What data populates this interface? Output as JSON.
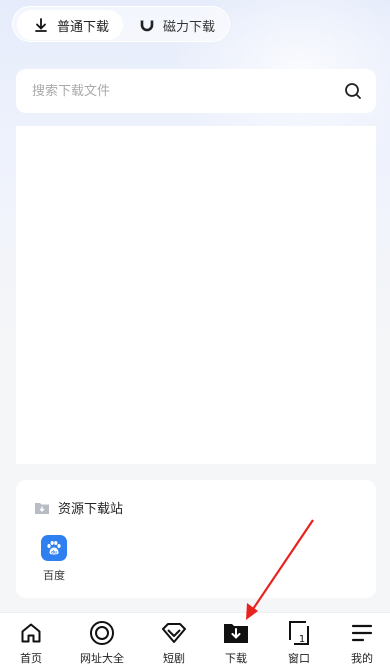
{
  "segmented": {
    "normal_label": "普通下载",
    "magnet_label": "磁力下载"
  },
  "search": {
    "placeholder": "搜索下载文件"
  },
  "resources": {
    "title": "资源下载站",
    "sites": [
      {
        "label": "百度",
        "icon": "baidu-paw-icon",
        "color": "#2e7ff0"
      }
    ]
  },
  "tabbar": {
    "items": [
      {
        "label": "首页",
        "icon": "home-icon"
      },
      {
        "label": "网址大全",
        "icon": "target-circle-icon"
      },
      {
        "label": "短剧",
        "icon": "diamond-icon"
      },
      {
        "label": "下载",
        "icon": "download-folder-icon"
      },
      {
        "label": "窗口",
        "icon": "window-icon",
        "badge": "1"
      },
      {
        "label": "我的",
        "icon": "menu-lines-icon"
      }
    ]
  },
  "annotation": {
    "arrow_color": "#e8231f"
  }
}
